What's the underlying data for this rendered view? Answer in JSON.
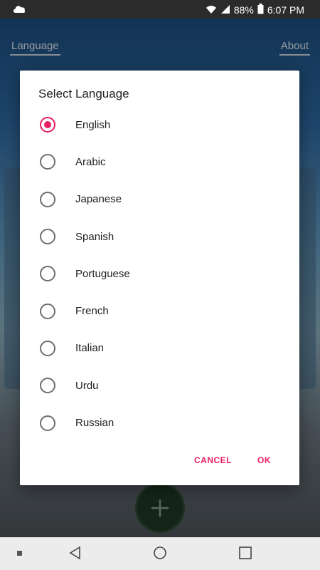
{
  "status_bar": {
    "battery": "88%",
    "time": "6:07 PM",
    "icons": [
      "cloud-icon",
      "wifi-icon",
      "signal-icon",
      "battery-icon"
    ]
  },
  "background": {
    "tabs": {
      "language": "Language",
      "about": "About"
    }
  },
  "dialog": {
    "title": "Select Language",
    "options": [
      {
        "label": "English",
        "checked": true
      },
      {
        "label": "Arabic",
        "checked": false
      },
      {
        "label": "Japanese",
        "checked": false
      },
      {
        "label": "Spanish",
        "checked": false
      },
      {
        "label": "Portuguese",
        "checked": false
      },
      {
        "label": "French",
        "checked": false
      },
      {
        "label": "Italian",
        "checked": false
      },
      {
        "label": "Urdu",
        "checked": false
      },
      {
        "label": "Russian",
        "checked": false
      }
    ],
    "cancel_label": "CANCEL",
    "ok_label": "OK",
    "accent_color": "#e91e63"
  },
  "nav_bar": {
    "icons": [
      "back-icon",
      "home-icon",
      "recent-apps-icon"
    ]
  }
}
